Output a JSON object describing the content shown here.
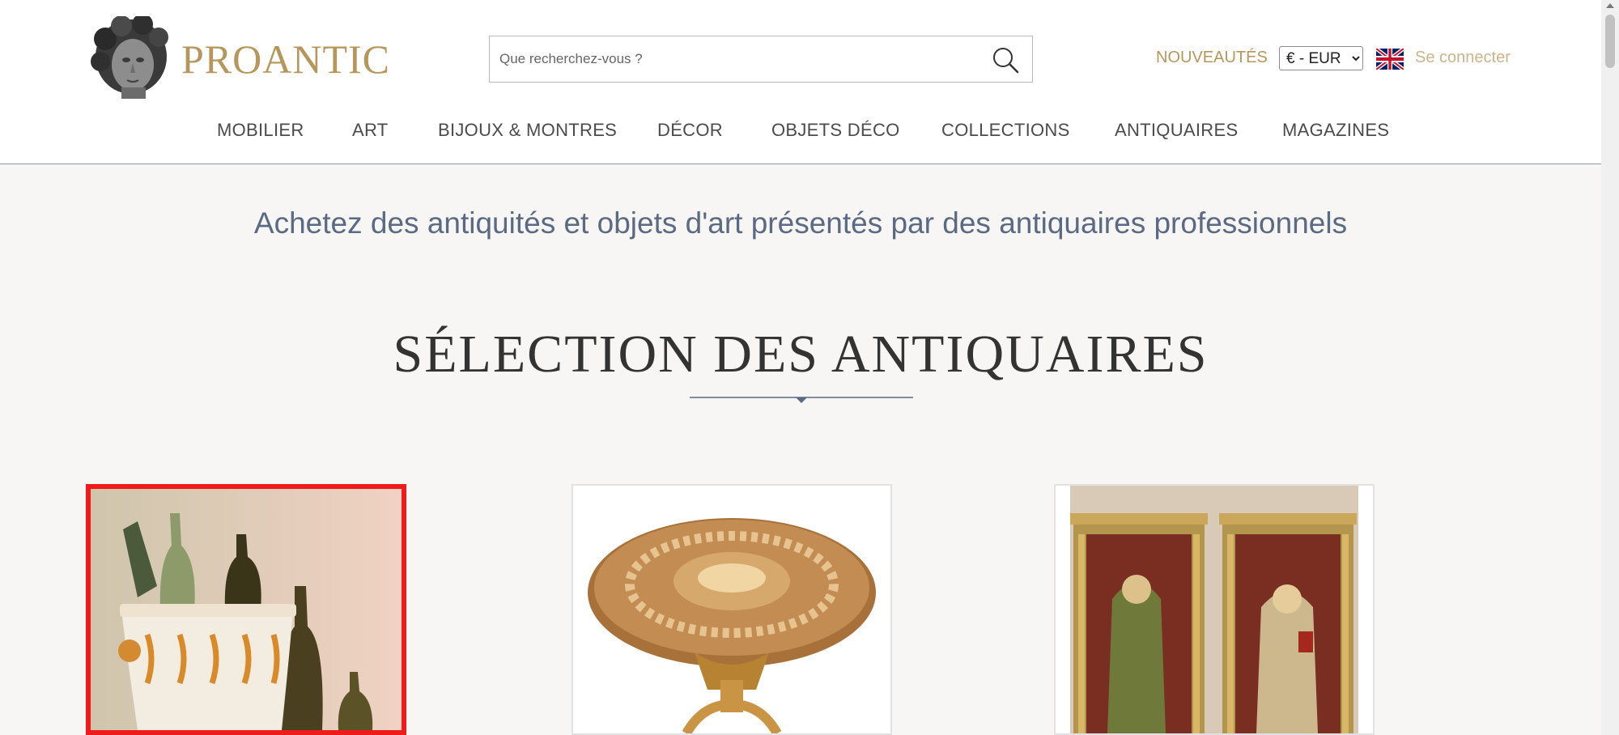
{
  "header": {
    "logo_text": "PROANTIC",
    "search_placeholder": "Que recherchez-vous ?",
    "nouveautes": "NOUVEAUTÉS",
    "currency_selected": "€ - EUR",
    "login": "Se connecter"
  },
  "nav": {
    "items": [
      "MOBILIER",
      "ART",
      "BIJOUX & MONTRES",
      "DÉCOR",
      "OBJETS DÉCO",
      "COLLECTIONS",
      "ANTIQUAIRES",
      "MAGAZINES"
    ]
  },
  "main": {
    "tagline": "Achetez des antiquités et objets d'art présentés par des antiquaires professionnels",
    "section_title": "SÉLECTION DES ANTIQUAIRES"
  },
  "products": [
    {
      "image": "bottles-in-faience-cooler",
      "selected": true
    },
    {
      "image": "round-marquetry-pedestal-table",
      "selected": false
    },
    {
      "image": "pair-of-painted-saint-panels",
      "selected": false
    }
  ],
  "colors": {
    "gold": "#b6965a",
    "selection_border": "#ef1b1b",
    "tagline": "#5a6a82",
    "background": "#f7f6f4"
  }
}
